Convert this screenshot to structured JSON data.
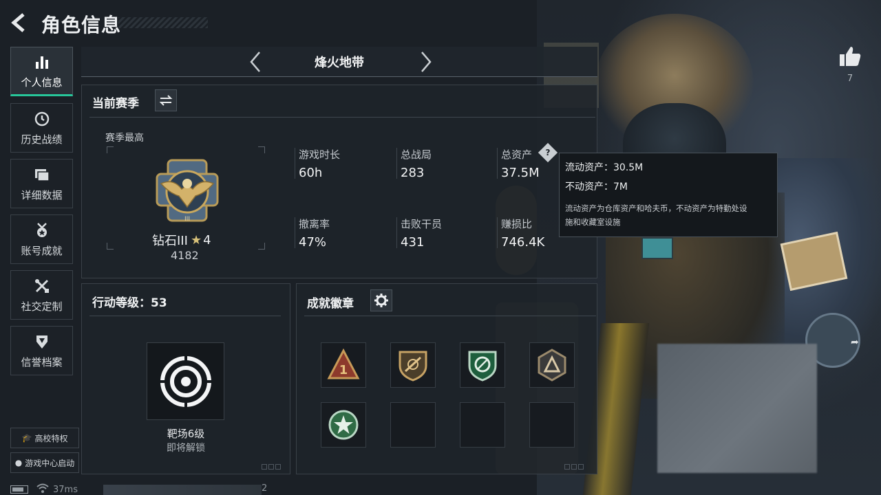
{
  "header": {
    "title": "角色信息"
  },
  "sidebar": {
    "items": [
      {
        "label": "个人信息",
        "icon": "bar-chart-icon",
        "active": true
      },
      {
        "label": "历史战绩",
        "icon": "clock-icon",
        "active": false
      },
      {
        "label": "详细数据",
        "icon": "folder-icon",
        "active": false
      },
      {
        "label": "账号成就",
        "icon": "medal-icon",
        "active": false
      },
      {
        "label": "社交定制",
        "icon": "tools-icon",
        "active": false
      },
      {
        "label": "信誉档案",
        "icon": "shield-icon",
        "active": false
      }
    ],
    "campus_label": "高校特权",
    "game_center_label": "游戏中心启动"
  },
  "mode": {
    "title": "烽火地带"
  },
  "season": {
    "title": "当前赛季",
    "best_label": "赛季最高",
    "rank_name": "钻石III",
    "rank_stars": "4",
    "rank_score": "4182",
    "stats": [
      {
        "label": "游戏时长",
        "value": "60h"
      },
      {
        "label": "总战局",
        "value": "283"
      },
      {
        "label": "总资产",
        "value": "37.5M"
      },
      {
        "label": "撤离率",
        "value": "47%"
      },
      {
        "label": "击败干员",
        "value": "431"
      },
      {
        "label": "赚损比",
        "value": "746.4K"
      }
    ]
  },
  "tooltip": {
    "liquid": "流动资产：30.5M",
    "fixed": "不动资产：7M",
    "desc1": "流动资产为仓库资产和哈夫币，不动资产为特勤处设",
    "desc2": "施和收藏室设施"
  },
  "level": {
    "title": "行动等级：53",
    "range_name": "靶场6级",
    "range_status": "即将解锁"
  },
  "badges": {
    "title": "成就徽章"
  },
  "like": {
    "count": "7"
  },
  "status": {
    "ping": "37ms",
    "name_suffix": "2"
  },
  "colors": {
    "accent": "#27c79a",
    "background": "#1b2026",
    "panel_border": "#3a4148"
  }
}
